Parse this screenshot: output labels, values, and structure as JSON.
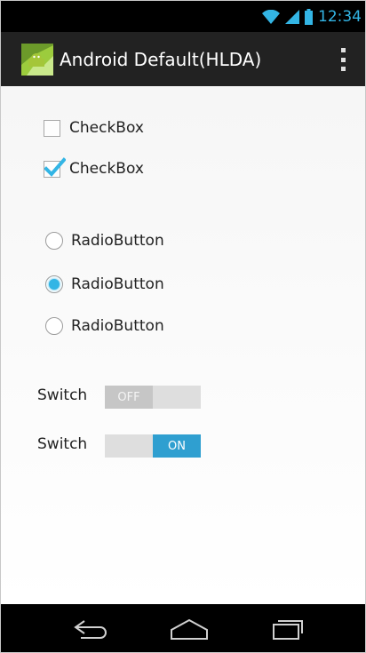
{
  "status_bar": {
    "time": "12:34",
    "accent_color": "#33b5e5",
    "icons": [
      "wifi-icon",
      "signal-icon",
      "battery-icon"
    ]
  },
  "action_bar": {
    "title": "Android Default(HLDA)",
    "app_icon": "android-app-icon",
    "menu_icon": "overflow-menu-icon"
  },
  "checkboxes": [
    {
      "label": "CheckBox",
      "checked": false
    },
    {
      "label": "CheckBox",
      "checked": true
    }
  ],
  "radio_buttons": [
    {
      "label": "RadioButton",
      "checked": false
    },
    {
      "label": "RadioButton",
      "checked": true
    },
    {
      "label": "RadioButton",
      "checked": false
    }
  ],
  "switches": [
    {
      "label": "Switch",
      "state_text": "OFF",
      "on": false
    },
    {
      "label": "Switch",
      "state_text": "ON",
      "on": true
    }
  ],
  "nav_bar": {
    "buttons": [
      "back-icon",
      "home-icon",
      "recent-apps-icon"
    ]
  }
}
